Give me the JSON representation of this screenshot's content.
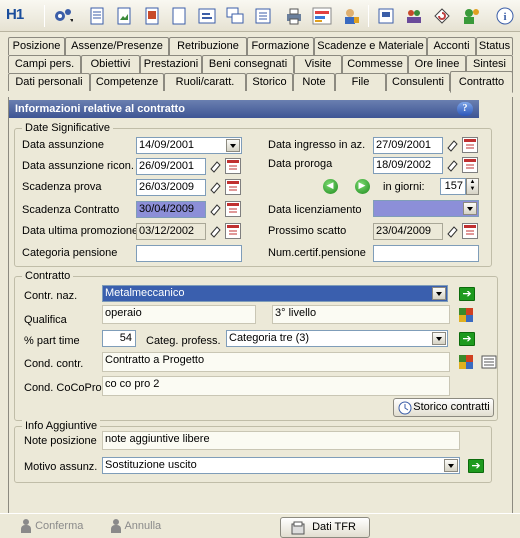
{
  "toolbar": {
    "logo": "H1",
    "icons": [
      "settings-menu-icon",
      "document-icon",
      "image-icon",
      "photo-icon",
      "blank-page-icon",
      "form-icon",
      "windows-icon",
      "list-icon",
      "printer-icon",
      "chart-icon",
      "person-card-icon",
      "save-icon",
      "users-icon",
      "refresh-icon",
      "user-settings-icon",
      "info-icon"
    ]
  },
  "tabs": {
    "row1": [
      "Posizione",
      "Assenze/Presenze",
      "Retribuzione",
      "Formazione",
      "Scadenze e Materiale",
      "Acconti",
      "Status"
    ],
    "row2": [
      "Campi pers.",
      "Obiettivi",
      "Prestazioni",
      "Beni consegnati",
      "Visite",
      "Commesse",
      "Ore linee",
      "Sintesi"
    ],
    "row3": [
      "Dati personali",
      "Competenze",
      "Ruoli/caratt.",
      "Storico",
      "Note",
      "File",
      "Consulenti",
      "Contratto"
    ]
  },
  "header": {
    "title": "Informazioni relative al contratto",
    "help": "?"
  },
  "date_section": {
    "legend": "Date Significative",
    "data_assunzione": {
      "label": "Data assunzione",
      "value": "14/09/2001"
    },
    "data_assunzione_ricon": {
      "label": "Data assunzione ricon.",
      "value": "26/09/2001"
    },
    "scadenza_prova": {
      "label": "Scadenza prova",
      "value": "26/03/2009"
    },
    "scadenza_contratto": {
      "label": "Scadenza Contratto",
      "value": "30/04/2009"
    },
    "data_ultima_promozione": {
      "label": "Data ultima promozione",
      "value": "03/12/2002"
    },
    "categoria_pensione": {
      "label": "Categoria pensione",
      "value": ""
    },
    "data_ingresso": {
      "label": "Data ingresso in az.",
      "value": "27/09/2001"
    },
    "data_proroga": {
      "label": "Data proroga",
      "value": "18/09/2002"
    },
    "in_giorni": {
      "label": "in giorni:",
      "value": "157"
    },
    "data_licenziamento": {
      "label": "Data licenziamento",
      "value": ""
    },
    "prossimo_scatto": {
      "label": "Prossimo scatto",
      "value": "23/04/2009"
    },
    "num_certif_pensione": {
      "label": "Num.certif.pensione",
      "value": ""
    }
  },
  "contract_section": {
    "legend": "Contratto",
    "contr_naz": {
      "label": "Contr. naz.",
      "value": "Metalmeccanico"
    },
    "qualifica": {
      "label": "Qualifica",
      "value": "operaio",
      "livello": "3° livello"
    },
    "part_time": {
      "label": "% part time",
      "value": "54"
    },
    "categ_profess": {
      "label": "Categ. profess.",
      "value": "Categoria tre (3)"
    },
    "cond_contr": {
      "label": "Cond. contr.",
      "value": "Contratto a Progetto"
    },
    "cond_cocopro": {
      "label": "Cond. CoCoPro",
      "value": "co co pro 2"
    },
    "storico_button": "Storico contratti"
  },
  "info_section": {
    "legend": "Info Aggiuntive",
    "note_posizione": {
      "label": "Note posizione",
      "value": "note aggiuntive libere"
    },
    "motivo_assunz": {
      "label": "Motivo assunz.",
      "value": "Sostituzione uscito"
    }
  },
  "bottom": {
    "confirm": "Conferma",
    "cancel": "Annulla",
    "tfr": "Dati TFR"
  },
  "colors": {
    "header_bar": "#3e5594",
    "selection": "#3a5fae",
    "highlight_date": "#8c8fd8",
    "background": "#ece9d8"
  }
}
